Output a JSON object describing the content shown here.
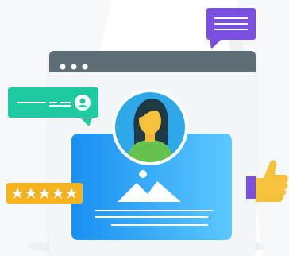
{
  "illustration": {
    "subject": "user-profile-review",
    "rating": {
      "value": 5,
      "max": 5
    },
    "colors": {
      "window_frame": "#F4F5F7",
      "window_titlebar": "#5E6E76",
      "avatar_ring": "#2EA8E8",
      "profile_card_start": "#1990F2",
      "profile_card_end": "#5CC8FF",
      "chat_green": "#1ECBA0",
      "chat_purple": "#7B4FE0",
      "rating_badge": "#F6B31C",
      "thumb_skin": "#F6C23C",
      "thumb_cuff": "#7B4FE0"
    },
    "icons": [
      "window-dots-icon",
      "user-avatar-icon",
      "image-placeholder-icon",
      "chat-bubble-icon",
      "user-icon",
      "star-icon",
      "thumbs-up-icon"
    ]
  }
}
